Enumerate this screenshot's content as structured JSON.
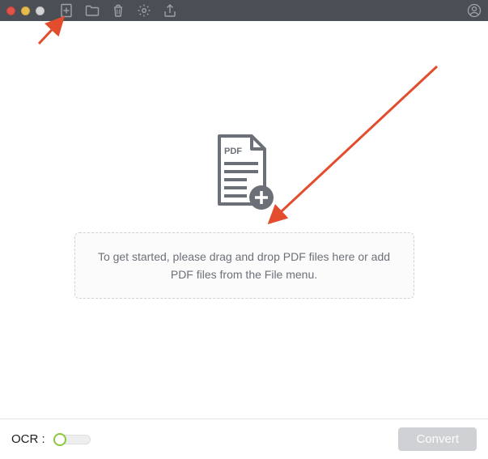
{
  "titlebar": {
    "icons": {
      "add": "add-file-icon",
      "open": "folder-open-icon",
      "delete": "trash-icon",
      "settings": "gear-icon",
      "export": "export-icon",
      "user": "user-icon"
    }
  },
  "main": {
    "pdf_badge": "PDF",
    "dropzone_text": "To get started, please drag and drop PDF files here or add PDF files from the File menu."
  },
  "footer": {
    "ocr_label": "OCR :",
    "ocr_on": false,
    "convert_label": "Convert"
  },
  "colors": {
    "toolbar_bg": "#4a4e55",
    "icon_stroke": "#9ea2a9",
    "accent_green": "#8dc63f",
    "arrow": "#e34c2d"
  }
}
